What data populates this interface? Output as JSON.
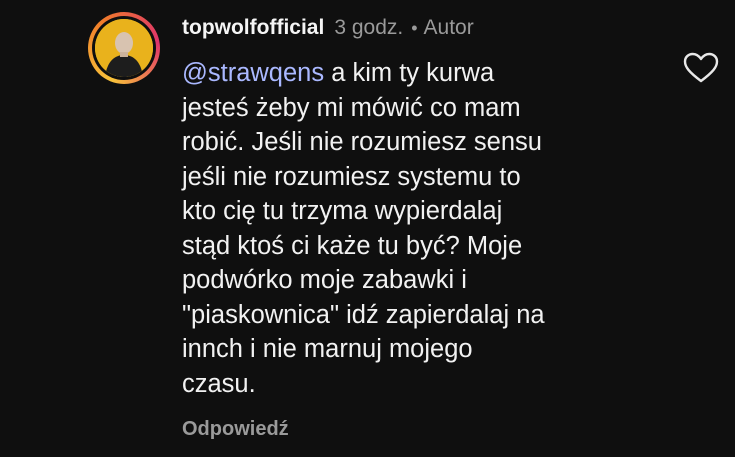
{
  "comment": {
    "username": "topwolfofficial",
    "time": "3 godz.",
    "separator": "•",
    "author_badge": "Autor",
    "mention": "@strawqens",
    "text_lines": [
      "a kim ty kurwa",
      "jesteś żeby mi mówić co mam",
      "robić. Jeśli nie rozumiesz sensu",
      "jeśli nie rozumiesz systemu to",
      "kto cię tu trzyma wypierdalaj",
      "stąd ktoś ci każe tu być? Moje",
      "podwórko moje zabawki i",
      "\"piaskownica\" idź zapierdalaj na",
      "innch i nie marnuj mojego",
      "czasu."
    ],
    "reply_label": "Odpowiedź",
    "like_icon": "heart-outline-icon"
  },
  "colors": {
    "background": "#0f0f0f",
    "text": "#f2f2f2",
    "muted": "#9a9a9a",
    "mention": "#aab8ff",
    "avatar_bg": "#e9b21c"
  }
}
